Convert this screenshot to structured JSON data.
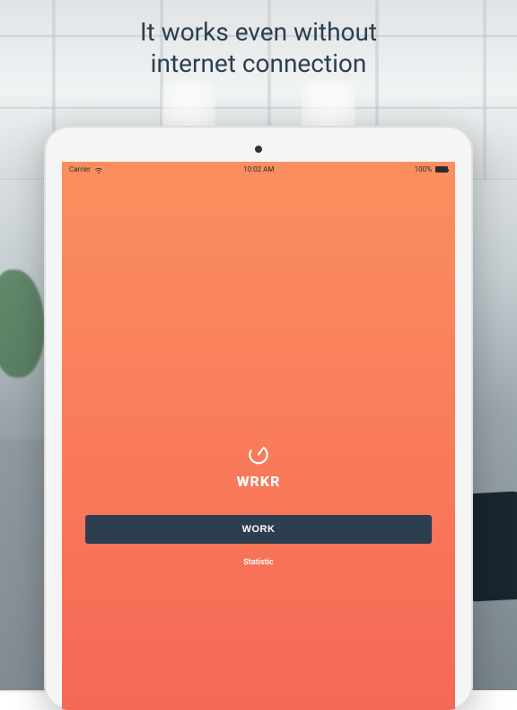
{
  "headline": {
    "line1": "It works even without",
    "line2": "internet connection"
  },
  "status_bar": {
    "carrier": "Carrier",
    "time": "10:02 AM",
    "battery": "100%"
  },
  "app": {
    "name": "WRKR",
    "work_button_label": "WORK",
    "statistic_link_label": "Statistic"
  },
  "colors": {
    "headline_text": "#2c3e50",
    "app_gradient_start": "#fb8f5f",
    "app_gradient_end": "#f56856",
    "button_bg": "#2c3e50",
    "app_text": "#ffffff"
  }
}
